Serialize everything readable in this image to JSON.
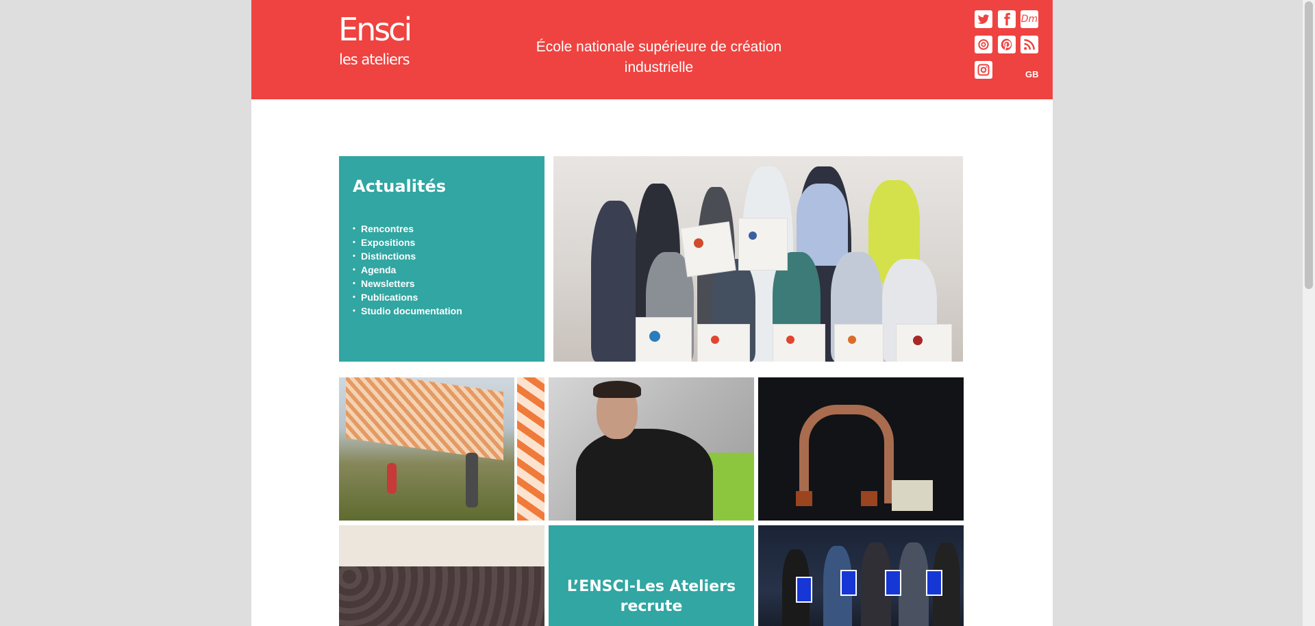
{
  "header": {
    "logo_main": "Ensci",
    "logo_sub": "les ateliers",
    "tagline": "École nationale supérieure de création industrielle",
    "lang_label": "GB",
    "social_icons": [
      "twitter-icon",
      "facebook-icon",
      "dm-icon",
      "issuu-icon",
      "pinterest-icon",
      "rss-icon",
      "instagram-icon"
    ],
    "dm_label": "Dm"
  },
  "news": {
    "title": "Actualités",
    "items": [
      "Rencontres",
      "Expositions",
      "Distinctions",
      "Agenda",
      "Newsletters",
      "Publications",
      "Studio documentation"
    ]
  },
  "tiles": {
    "recruit_line1": "L’ENSCI-Les Ateliers",
    "recruit_line2": "recrute"
  },
  "colors": {
    "brand_red": "#ee4340",
    "teal": "#31a6a2",
    "background": "#dedede"
  }
}
